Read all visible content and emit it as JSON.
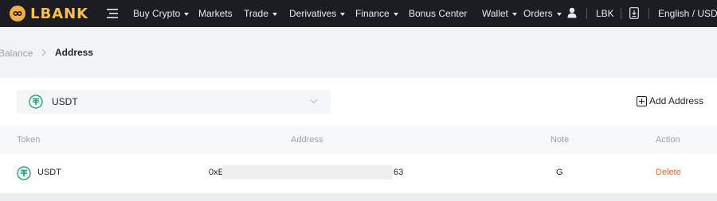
{
  "nav": {
    "brand": "LBANK",
    "items": [
      {
        "label": "Buy Crypto",
        "dropdown": true
      },
      {
        "label": "Markets",
        "dropdown": false
      },
      {
        "label": "Trade",
        "dropdown": true
      },
      {
        "label": "Derivatives",
        "dropdown": true
      },
      {
        "label": "Finance",
        "dropdown": true
      },
      {
        "label": "Bonus Center",
        "dropdown": false
      }
    ],
    "right": {
      "wallet": "Wallet",
      "orders": "Orders",
      "token": "LBK",
      "locale": "English / USD"
    },
    "colors": {
      "bar": "#1b1d23",
      "brand": "#f5c152"
    }
  },
  "breadcrumb": {
    "previous": "Balance",
    "current": "Address"
  },
  "selector": {
    "value": "USDT",
    "icon": "tether-icon"
  },
  "add_address_label": "Add Address",
  "table": {
    "headers": [
      "Token",
      "Address",
      "Note",
      "Action"
    ],
    "rows": [
      {
        "token": "USDT",
        "address_prefix": "0xE",
        "address_suffix": "63",
        "note": "G",
        "action": "Delete"
      }
    ]
  },
  "accent": {
    "delete": "#e8663a",
    "tether": "#26a17b"
  }
}
